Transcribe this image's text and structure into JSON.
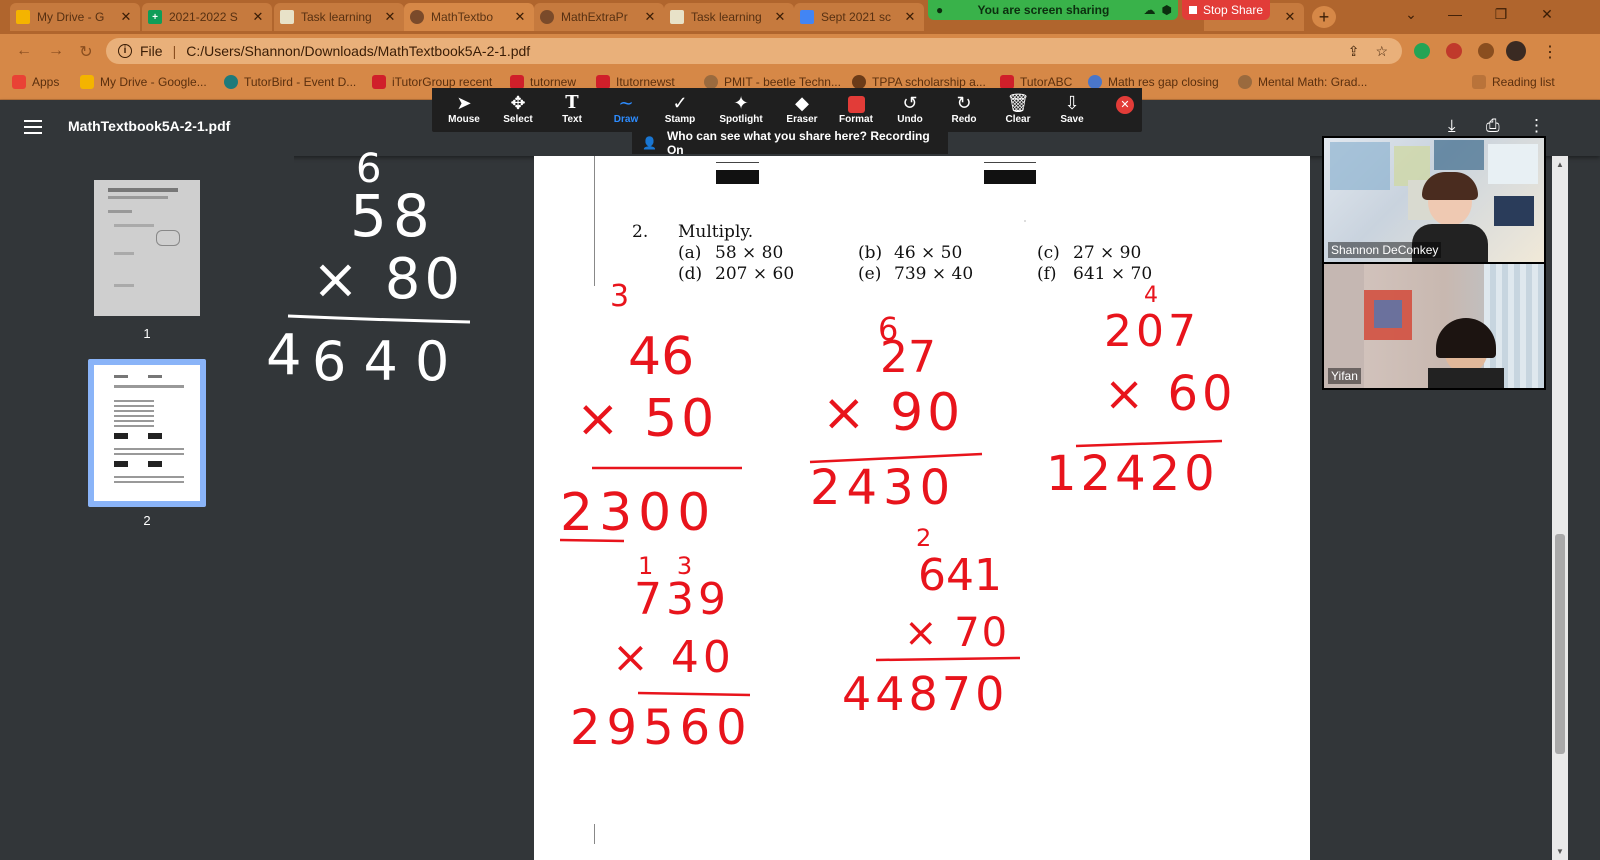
{
  "tabs": [
    {
      "label": "My Drive - G",
      "fav_color": "#f4b400"
    },
    {
      "label": "2021-2022 S",
      "fav_color": "#0f9d58"
    },
    {
      "label": "Task learning",
      "fav_color": "#e8e2c8"
    },
    {
      "label": "MathTextbo",
      "fav_color": "#7a4a2a"
    },
    {
      "label": "MathExtraPr",
      "fav_color": "#7a4a2a"
    },
    {
      "label": "Task learning",
      "fav_color": "#e8e2c8"
    },
    {
      "label": "Sept 2021 sc",
      "fav_color": "#4285f4"
    }
  ],
  "share": {
    "status": "You are screen sharing",
    "stop": "Stop Share"
  },
  "address": {
    "protocol": "File",
    "url": "C:/Users/Shannon/Downloads/MathTextbook5A-2-1.pdf"
  },
  "bookmarks": [
    {
      "label": "Apps"
    },
    {
      "label": "My Drive - Google..."
    },
    {
      "label": "TutorBird - Event D..."
    },
    {
      "label": "iTutorGroup recent"
    },
    {
      "label": "tutornew"
    },
    {
      "label": "Itutornewst"
    },
    {
      "label": "PMIT - beetle Techn..."
    },
    {
      "label": "TPPA scholarship a..."
    },
    {
      "label": "TutorABC"
    },
    {
      "label": "Math res gap closing"
    },
    {
      "label": "Mental Math: Grad..."
    },
    {
      "label": "Reading list"
    }
  ],
  "pdf": {
    "title": "MathTextbook5A-2-1.pdf",
    "pages": [
      "1",
      "2"
    ]
  },
  "annotation_tools": [
    {
      "label": "Mouse",
      "icon": "cursor-icon"
    },
    {
      "label": "Select",
      "icon": "move-icon"
    },
    {
      "label": "Text",
      "icon": "text-icon"
    },
    {
      "label": "Draw",
      "icon": "draw-icon"
    },
    {
      "label": "Stamp",
      "icon": "stamp-icon"
    },
    {
      "label": "Spotlight",
      "icon": "spotlight-icon"
    },
    {
      "label": "Eraser",
      "icon": "eraser-icon"
    },
    {
      "label": "Format",
      "icon": "format-icon"
    },
    {
      "label": "Undo",
      "icon": "undo-icon"
    },
    {
      "label": "Redo",
      "icon": "redo-icon"
    },
    {
      "label": "Clear",
      "icon": "trash-icon"
    },
    {
      "label": "Save",
      "icon": "save-icon"
    }
  ],
  "who_can_see": "Who can see what you share here? Recording On",
  "document": {
    "question_number": "2.",
    "instruction": "Multiply.",
    "problems": [
      {
        "tag": "(a)",
        "expr": "58 × 80"
      },
      {
        "tag": "(b)",
        "expr": "46 × 50"
      },
      {
        "tag": "(c)",
        "expr": "27 × 90"
      },
      {
        "tag": "(d)",
        "expr": "207 × 60"
      },
      {
        "tag": "(e)",
        "expr": "739 × 40"
      },
      {
        "tag": "(f)",
        "expr": "641 × 70"
      }
    ]
  },
  "ink": {
    "white_work": {
      "carry": "6",
      "top": "58",
      "multiplier": "× 80",
      "result_lead": "4",
      "result": "6 4 0"
    },
    "red_work": [
      {
        "carry": "3",
        "top": "46",
        "multiplier": "× 50",
        "result": "2300"
      },
      {
        "carry": "6",
        "top": "27",
        "multiplier": "×  90",
        "result": "2430"
      },
      {
        "carry": "4",
        "top": "207",
        "multiplier": "× 60",
        "result": "12420"
      },
      {
        "carry": "1  3",
        "top": "739",
        "multiplier": "×  40",
        "result": "29560"
      },
      {
        "carry": "2",
        "top": "641",
        "multiplier": "× 70",
        "result": "44870"
      }
    ],
    "colors": {
      "red": "#e8141c",
      "white": "#ffffff"
    }
  },
  "participants": [
    {
      "name": "Shannon DeConkey"
    },
    {
      "name": "Yifan"
    }
  ]
}
